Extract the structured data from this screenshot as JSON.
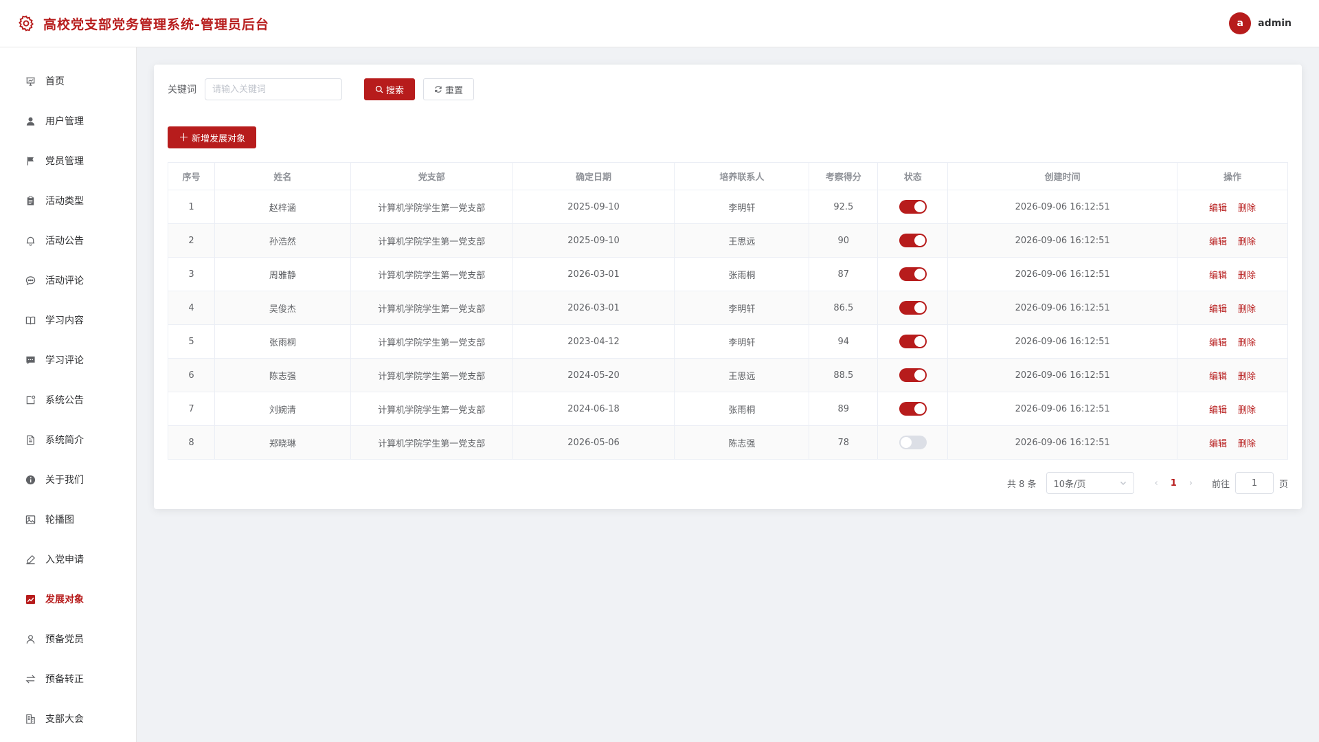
{
  "header": {
    "title": "高校党支部党务管理系统-管理员后台",
    "avatar_letter": "a",
    "username": "admin"
  },
  "sidebar": {
    "items": [
      {
        "label": "首页",
        "icon": "presentation-icon"
      },
      {
        "label": "用户管理",
        "icon": "user-icon"
      },
      {
        "label": "党员管理",
        "icon": "flag-icon"
      },
      {
        "label": "活动类型",
        "icon": "clipboard-icon"
      },
      {
        "label": "活动公告",
        "icon": "bell-icon"
      },
      {
        "label": "活动评论",
        "icon": "chat-dots-icon"
      },
      {
        "label": "学习内容",
        "icon": "book-icon"
      },
      {
        "label": "学习评论",
        "icon": "chat-square-icon"
      },
      {
        "label": "系统公告",
        "icon": "notification-icon"
      },
      {
        "label": "系统简介",
        "icon": "document-icon"
      },
      {
        "label": "关于我们",
        "icon": "info-icon"
      },
      {
        "label": "轮播图",
        "icon": "picture-icon"
      },
      {
        "label": "入党申请",
        "icon": "edit-pen-icon"
      },
      {
        "label": "发展对象",
        "icon": "trend-chart-icon"
      },
      {
        "label": "预备党员",
        "icon": "user-outline-icon"
      },
      {
        "label": "预备转正",
        "icon": "switch-icon"
      },
      {
        "label": "支部大会",
        "icon": "office-building-icon"
      }
    ],
    "active_index": 13
  },
  "search": {
    "label": "关键词",
    "placeholder": "请输入关键词",
    "value": "",
    "search_button": "搜索",
    "reset_button": "重置"
  },
  "add_button": "新增发展对象",
  "accent_color": "#b71c1c",
  "table": {
    "columns": [
      "序号",
      "姓名",
      "党支部",
      "确定日期",
      "培养联系人",
      "考察得分",
      "状态",
      "创建时间",
      "操作"
    ],
    "rows": [
      {
        "index": "1",
        "name": "赵梓涵",
        "branch": "计算机学院学生第一党支部",
        "date": "2025-09-10",
        "contact": "李明轩",
        "score": "92.5",
        "status": true,
        "created": "2026-09-06 16:12:51"
      },
      {
        "index": "2",
        "name": "孙浩然",
        "branch": "计算机学院学生第一党支部",
        "date": "2025-09-10",
        "contact": "王思远",
        "score": "90",
        "status": true,
        "created": "2026-09-06 16:12:51"
      },
      {
        "index": "3",
        "name": "周雅静",
        "branch": "计算机学院学生第一党支部",
        "date": "2026-03-01",
        "contact": "张雨桐",
        "score": "87",
        "status": true,
        "created": "2026-09-06 16:12:51"
      },
      {
        "index": "4",
        "name": "吴俊杰",
        "branch": "计算机学院学生第一党支部",
        "date": "2026-03-01",
        "contact": "李明轩",
        "score": "86.5",
        "status": true,
        "created": "2026-09-06 16:12:51"
      },
      {
        "index": "5",
        "name": "张雨桐",
        "branch": "计算机学院学生第一党支部",
        "date": "2023-04-12",
        "contact": "李明轩",
        "score": "94",
        "status": true,
        "created": "2026-09-06 16:12:51"
      },
      {
        "index": "6",
        "name": "陈志强",
        "branch": "计算机学院学生第一党支部",
        "date": "2024-05-20",
        "contact": "王思远",
        "score": "88.5",
        "status": true,
        "created": "2026-09-06 16:12:51"
      },
      {
        "index": "7",
        "name": "刘婉清",
        "branch": "计算机学院学生第一党支部",
        "date": "2024-06-18",
        "contact": "张雨桐",
        "score": "89",
        "status": true,
        "created": "2026-09-06 16:12:51"
      },
      {
        "index": "8",
        "name": "郑晓琳",
        "branch": "计算机学院学生第一党支部",
        "date": "2026-05-06",
        "contact": "陈志强",
        "score": "78",
        "status": false,
        "created": "2026-09-06 16:12:51"
      }
    ],
    "edit_label": "编辑",
    "delete_label": "删除"
  },
  "pagination": {
    "total_text": "共 8 条",
    "page_size": "10条/页",
    "current_page": "1",
    "goto_label": "前往",
    "goto_value": "1",
    "page_suffix": "页"
  }
}
